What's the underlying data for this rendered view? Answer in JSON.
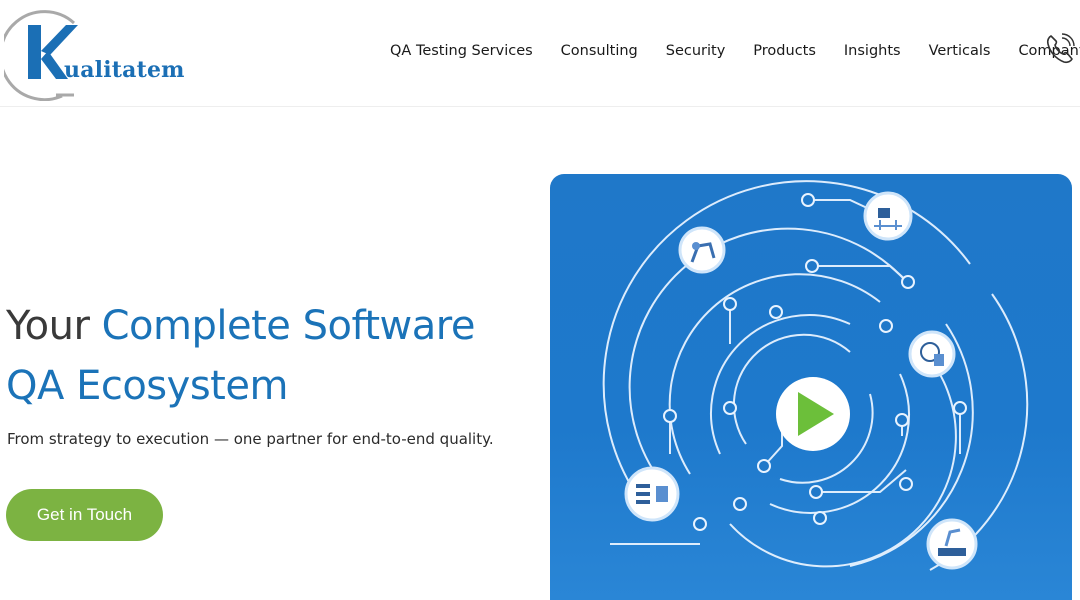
{
  "brand": {
    "logo_initial": "K",
    "logo_word": "ualitatem",
    "logo_colors": {
      "ring": "#a9a9a9",
      "text": "#1b6fb5"
    }
  },
  "nav": {
    "items": [
      {
        "label": "QA Testing Services"
      },
      {
        "label": "Consulting"
      },
      {
        "label": "Security"
      },
      {
        "label": "Products"
      },
      {
        "label": "Insights"
      },
      {
        "label": "Verticals"
      },
      {
        "label": "Company"
      }
    ],
    "phone_icon": "phone-icon"
  },
  "hero": {
    "headline_part1": "Your ",
    "headline_part2": "Complete Software",
    "headline_part3": "QA Ecosystem",
    "subtitle": "From strategy to execution — one partner for end-to-end quality.",
    "cta_label": "Get in Touch",
    "colors": {
      "headline_dark": "#3a3a3a",
      "headline_accent": "#1b73b8",
      "cta_bg": "#7cb342",
      "media_bg": "#1f78c9",
      "play": "#6cbf3a"
    },
    "media_icons": [
      "robot-arm-icon",
      "network-device-icon",
      "globe-document-icon",
      "server-stack-icon",
      "conveyor-robot-icon",
      "play-icon"
    ]
  }
}
